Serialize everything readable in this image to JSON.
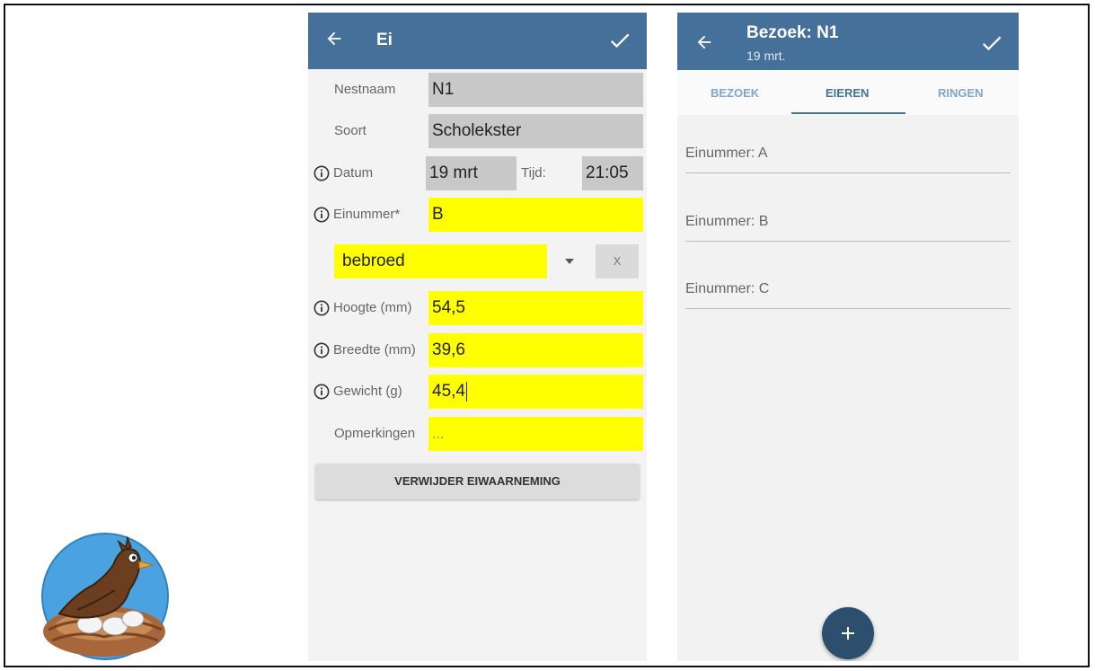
{
  "egg_screen": {
    "title": "Ei",
    "fields": {
      "nestnaam": {
        "label": "Nestnaam",
        "value": "N1"
      },
      "soort": {
        "label": "Soort",
        "value": "Scholekster"
      },
      "datum": {
        "label": "Datum",
        "value": "19 mrt"
      },
      "tijd": {
        "label": "Tijd:",
        "value": "21:05"
      },
      "einummer": {
        "label": "Einummer*",
        "value": "B"
      },
      "status": {
        "value": "bebroed",
        "clear_label": "X"
      },
      "hoogte": {
        "label": "Hoogte (mm)",
        "value": "54,5"
      },
      "breedte": {
        "label": "Breedte (mm)",
        "value": "39,6"
      },
      "gewicht": {
        "label": "Gewicht (g)",
        "value": "45,4"
      },
      "opmerkingen": {
        "label": "Opmerkingen",
        "placeholder": "..."
      }
    },
    "delete_button": "VERWIJDER EIWAARNEMING"
  },
  "visit_screen": {
    "title": "Bezoek: N1",
    "subtitle": "19 mrt.",
    "tabs": [
      "BEZOEK",
      "EIEREN",
      "RINGEN"
    ],
    "active_tab": "EIEREN",
    "eggs": [
      "Einummer: A",
      "Einummer: B",
      "Einummer: C"
    ],
    "fab_label": "+"
  },
  "colors": {
    "appbar": "#45709a",
    "highlight_field": "#ffff00",
    "readonly_field": "#c8c8c8",
    "fab": "#2c4f6e"
  },
  "icons": [
    "arrow-left-icon",
    "check-icon",
    "info-icon",
    "dropdown-arrow-icon",
    "plus-icon",
    "bird-nest-logo"
  ]
}
